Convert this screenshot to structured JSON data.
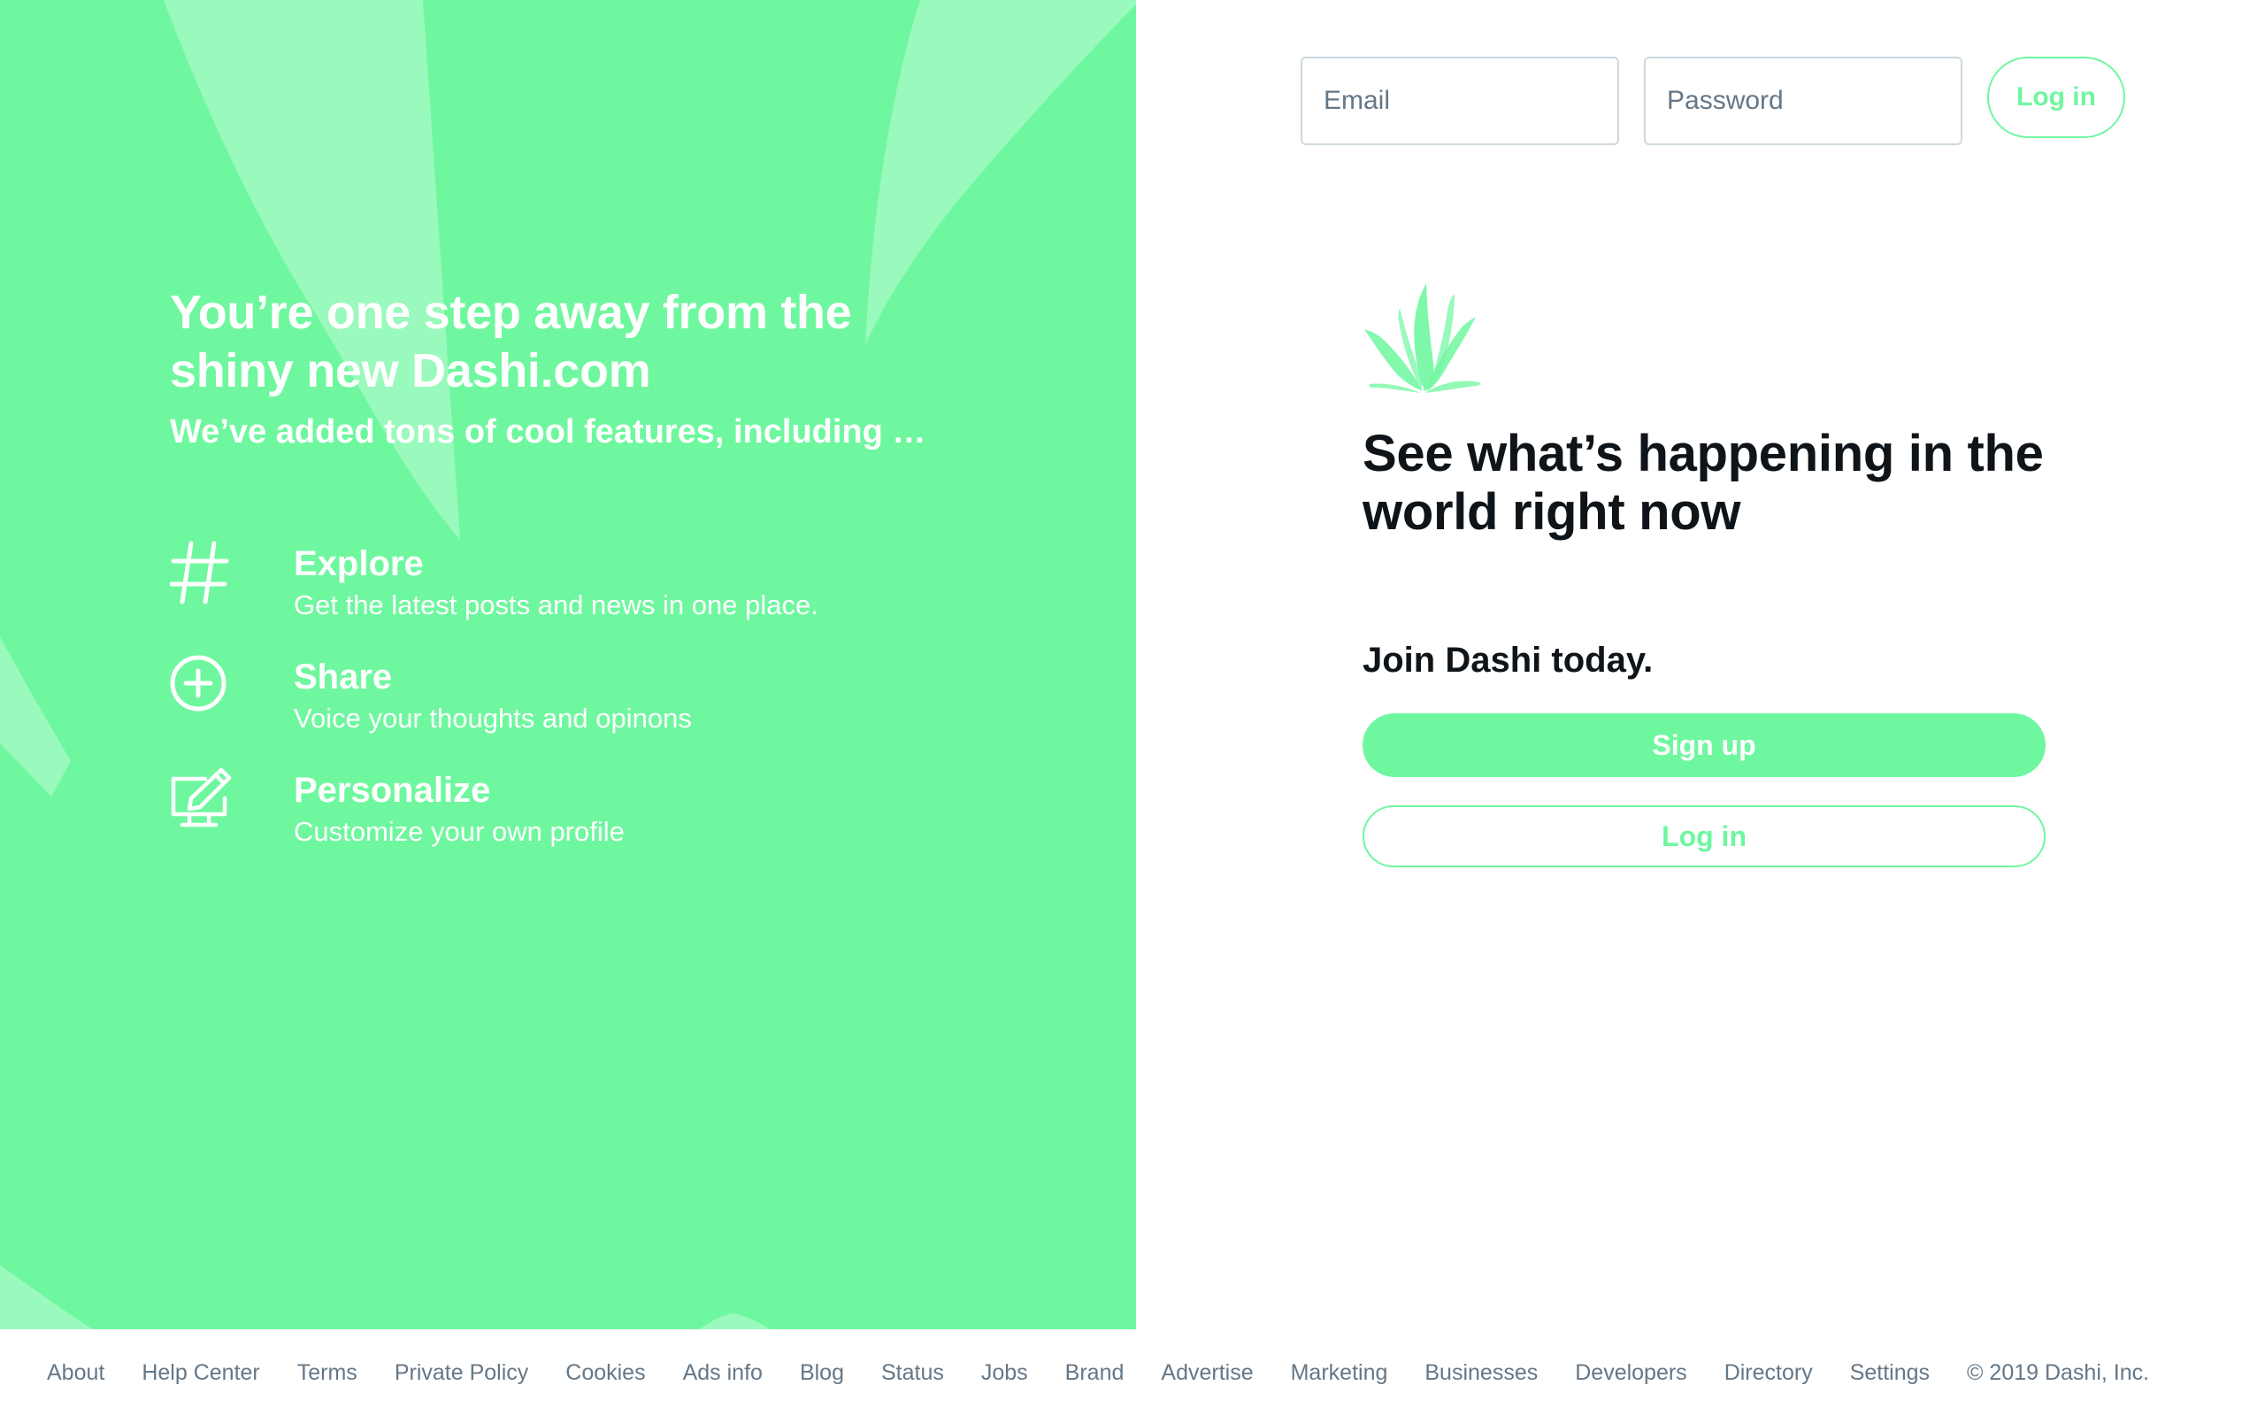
{
  "header": {
    "email_placeholder": "Email",
    "password_placeholder": "Password",
    "login_label": "Log in"
  },
  "promo": {
    "title": "You’re one step away from the shiny new Dashi.com",
    "subtitle": "We’ve added tons of cool features, including …",
    "features": [
      {
        "icon": "hashtag-icon",
        "title": "Explore",
        "description": "Get the latest posts and news in one place."
      },
      {
        "icon": "plus-circle-icon",
        "title": "Share",
        "description": "Voice your thoughts and opinons"
      },
      {
        "icon": "monitor-edit-icon",
        "title": "Personalize",
        "description": "Customize your own profile"
      }
    ]
  },
  "main": {
    "headline": "See what’s happening in the world right now",
    "join_text": "Join Dashi today.",
    "signup_label": "Sign up",
    "login_label": "Log in"
  },
  "footer": {
    "links": [
      "About",
      "Help Center",
      "Terms",
      "Private Policy",
      "Cookies",
      "Ads info",
      "Blog",
      "Status",
      "Jobs",
      "Brand",
      "Advertise",
      "Marketing",
      "Businesses",
      "Developers",
      "Directory",
      "Settings"
    ],
    "copyright": "© 2019 Dashi, Inc."
  },
  "colors": {
    "brand_green": "#6ff79f",
    "text_dark": "#0f1419",
    "footer_text": "#657786"
  }
}
